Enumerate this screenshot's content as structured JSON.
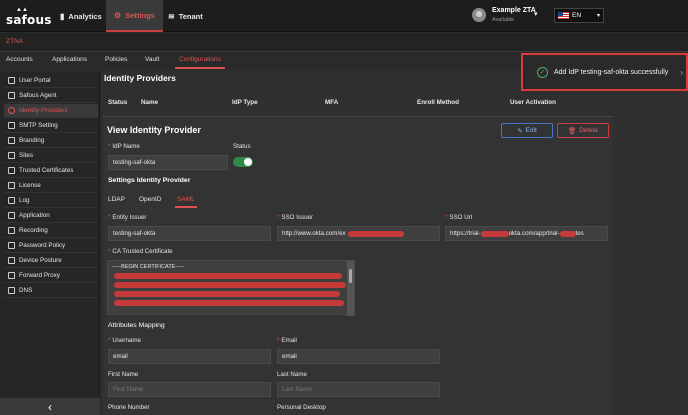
{
  "topbar": {
    "logo_text": "safous",
    "nav": [
      {
        "label": "Analytics",
        "icon": "bar-chart-icon"
      },
      {
        "label": "Settings",
        "icon": "gear-icon"
      },
      {
        "label": "Tenant",
        "icon": "layers-icon"
      }
    ],
    "user": {
      "name": "Example ZTA",
      "status": "Available"
    },
    "language": "EN"
  },
  "section_label": "ZTNA",
  "tabs": [
    "Accounts",
    "Applications",
    "Policies",
    "Vault",
    "Configurations"
  ],
  "active_tab": "Configurations",
  "sidebar": {
    "items": [
      "User Portal",
      "Safous Agent",
      "Identity Providers",
      "SMTP Setting",
      "Branding",
      "Sites",
      "Trusted Certificates",
      "License",
      "Log",
      "Application",
      "Recording",
      "Password Policy",
      "Device Posture",
      "Forward Proxy",
      "DNS"
    ],
    "active": "Identity Providers",
    "collapse_glyph": "‹"
  },
  "main": {
    "title": "Identity Providers",
    "columns": [
      "Status",
      "Name",
      "IdP Type",
      "MFA",
      "Enroll Method",
      "User Activation"
    ]
  },
  "panel": {
    "title": "View Identity Provider",
    "edit_label": "Edit",
    "delete_label": "Delete",
    "idp_name_label": "IdP Name",
    "idp_name_value": "testing-saf-okta",
    "status_label": "Status",
    "status_on": true,
    "settings_heading": "Settings Identity Provider",
    "sub_tabs": [
      "LDAP",
      "OpenID",
      "SAML"
    ],
    "active_sub_tab": "SAML",
    "entity_issuer_label": "Entity Issuer",
    "entity_issuer_value": "testing-saf-okta",
    "sso_issuer_label": "SSO Issuer",
    "sso_issuer_value": "http://www.okta.com/ex",
    "sso_url_label": "SSO Url",
    "sso_url_value": "https://trial-",
    "sso_url_mid": "okta.com/app/trial-",
    "sso_url_end": "tes",
    "ca_label": "CA Trusted Certificate",
    "ca_value": "-----BEGIN CERTIFICATE-----",
    "attributes_heading": "Attributes Mapping",
    "username_label": "Username",
    "username_value": "email",
    "email_label": "Email",
    "email_value": "email",
    "first_name_label": "First Name",
    "first_name_placeholder": "First Name",
    "last_name_label": "Last Name",
    "last_name_placeholder": "Last Name",
    "phone_label": "Phone Number",
    "desktop_label": "Personal Desktop"
  },
  "toast": {
    "message": "Add IdP testing-saf-okta successfully",
    "close_glyph": "›"
  },
  "colors": {
    "accent": "#e05252",
    "success": "#4caf6a",
    "toggle": "#2f8a4a"
  }
}
